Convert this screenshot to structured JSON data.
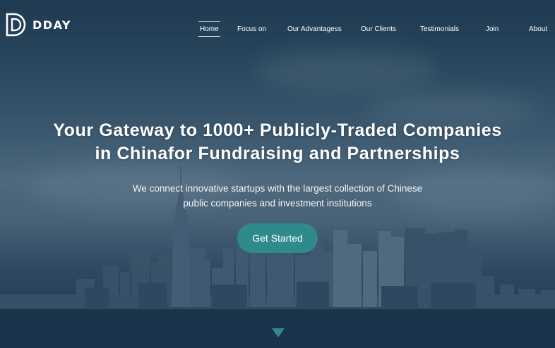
{
  "brand": {
    "name": "DDAY",
    "logo_icon": "dday-d-logo"
  },
  "nav": {
    "items": [
      {
        "label": "Home",
        "active": true
      },
      {
        "label": "Focus on",
        "active": false
      },
      {
        "label": "Our Advantagess",
        "active": false
      },
      {
        "label": "Our Clients",
        "active": false
      },
      {
        "label": "Testimonials",
        "active": false
      },
      {
        "label": "Join",
        "active": false
      },
      {
        "label": "About",
        "active": false
      }
    ]
  },
  "hero": {
    "headline_line1": "Your Gateway to 1000+ Publicly-Traded Companies",
    "headline_line2": "in Chinafor Fundraising and Partnerships",
    "subtitle_line1": "We connect innovative startups with the largest collection of Chinese",
    "subtitle_line2": "public companies and investment institutions",
    "cta_label": "Get Started",
    "scroll_icon": "triangle-down-icon"
  },
  "colors": {
    "accent": "#2f8a8c",
    "overlay": "#1e3a55"
  }
}
